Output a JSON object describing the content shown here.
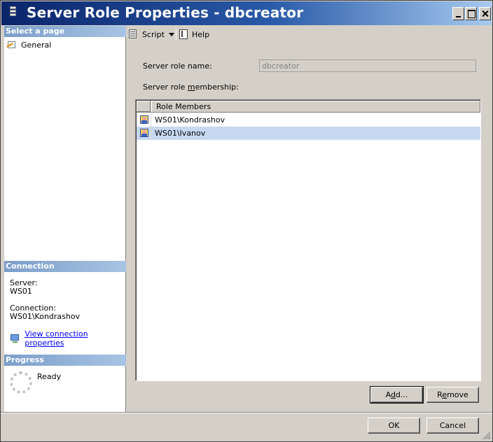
{
  "window": {
    "title": "Server Role Properties - dbcreator"
  },
  "left_pane": {
    "select_page_header": "Select a page",
    "pages": [
      {
        "label": "General",
        "icon": "general-page-icon"
      }
    ],
    "connection_header": "Connection",
    "server_label": "Server:",
    "server_value": "WS01",
    "connection_label": "Connection:",
    "connection_value": "WS01\\Kondrashov",
    "view_connection_link": "View connection properties",
    "progress_header": "Progress",
    "progress_status": "Ready"
  },
  "toolbar": {
    "script_label": "Script",
    "help_label": "Help"
  },
  "general": {
    "role_name_label": "Server role name:",
    "role_name_value": "dbcreator",
    "membership_label_prefix": "Server role ",
    "membership_label_underlined": "m",
    "membership_label_suffix": "embership:",
    "grid": {
      "column_header": "Role Members",
      "rows": [
        {
          "member": "WS01\\Kondrashov",
          "selected": false
        },
        {
          "member": "WS01\\Ivanov",
          "selected": true
        }
      ]
    },
    "add_label_prefix": "A",
    "add_label_underlined": "d",
    "add_label_suffix": "d...",
    "remove_label_prefix": "R",
    "remove_label_underlined": "e",
    "remove_label_suffix": "move"
  },
  "footer": {
    "ok_label": "OK",
    "cancel_label": "Cancel"
  },
  "colors": {
    "title_gradient_start": "#0a246a",
    "title_gradient_end": "#a6caf0",
    "section_header": "#7b9ec9",
    "selected_row": "#c7d9f1",
    "link": "#0000ff"
  }
}
